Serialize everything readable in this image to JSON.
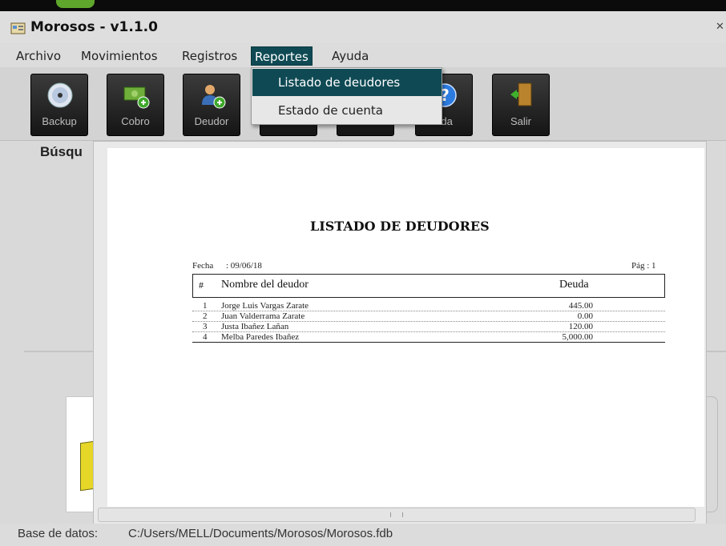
{
  "window": {
    "title": "Morosos - v1.1.0"
  },
  "menu": {
    "items": [
      {
        "label": "Archivo"
      },
      {
        "label": "Movimientos"
      },
      {
        "label": "Registros"
      },
      {
        "label": "Reportes"
      },
      {
        "label": "Ayuda"
      }
    ],
    "active_index": 3
  },
  "dropdown": {
    "items": [
      {
        "label": "Listado de deudores",
        "highlighted": true
      },
      {
        "label": "Estado de cuenta",
        "highlighted": false
      }
    ]
  },
  "toolbar": {
    "buttons": [
      {
        "label": "Backup",
        "icon": "disc-icon"
      },
      {
        "label": "Cobro",
        "icon": "money-add-icon"
      },
      {
        "label": "Deudor",
        "icon": "user-add-icon"
      },
      {
        "label": "",
        "icon": ""
      },
      {
        "label": "",
        "icon": ""
      },
      {
        "label": "uda",
        "icon": "help-icon"
      },
      {
        "label": "Salir",
        "icon": "exit-door-icon"
      }
    ]
  },
  "search": {
    "label": "Búsqu"
  },
  "report": {
    "title": "LISTADO DE DEUDORES",
    "date_label": "Fecha",
    "date_value": ": 09/06/18",
    "page_label": "Pág : 1",
    "columns": {
      "num": "#",
      "name": "Nombre del deudor",
      "debt": "Deuda"
    },
    "rows": [
      {
        "num": "1",
        "name": "Jorge Luis Vargas Zarate",
        "debt": "445.00"
      },
      {
        "num": "2",
        "name": "Juan Valderrama Zarate",
        "debt": "0.00"
      },
      {
        "num": "3",
        "name": "Justa Ibañez Lañan",
        "debt": "120.00"
      },
      {
        "num": "4",
        "name": "Melba Paredes Ibañez",
        "debt": "5,000.00"
      }
    ]
  },
  "status": {
    "db_label": "Base de datos:",
    "db_path": "C:/Users/MELL/Documents/Morosos/Morosos.fdb"
  },
  "colors": {
    "menu_highlight": "#0f4a54",
    "toolbar_button": "#1f1f1f",
    "background": "#d9d9d9"
  }
}
